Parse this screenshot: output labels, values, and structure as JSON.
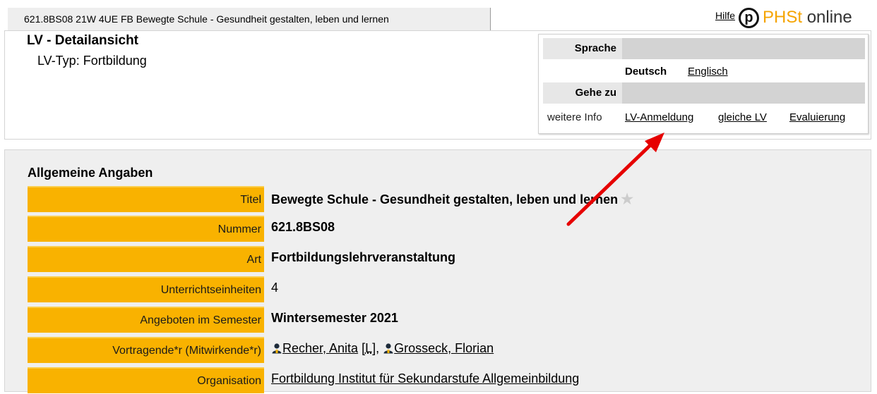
{
  "top_tab": {
    "title": "621.8BS08 21W 4UE FB Bewegte Schule - Gesundheit gestalten, leben und lernen"
  },
  "header": {
    "help_label": "Hilfe",
    "brand": {
      "logo_letter": "p",
      "name_part1": "PHSt",
      "name_part2": "online"
    },
    "page_title": "LV - Detailansicht",
    "lv_type": "LV-Typ: Fortbildung"
  },
  "nav_panel": {
    "language_heading": "Sprache",
    "language_current": "Deutsch",
    "language_alt": "Englisch",
    "goto_heading": "Gehe zu",
    "goto_static": "weitere Info",
    "goto_links": [
      "LV-Anmeldung",
      "gleiche LV",
      "Evaluierung"
    ]
  },
  "details": {
    "section_title": "Allgemeine Angaben",
    "rows": [
      {
        "label": "Titel",
        "value": "Bewegte Schule - Gesundheit gestalten, leben und lernen"
      },
      {
        "label": "Nummer",
        "value": "621.8BS08"
      },
      {
        "label": "Art",
        "value": "Fortbildungslehrveranstaltung"
      },
      {
        "label": "Unterrichtseinheiten",
        "value": "4"
      },
      {
        "label": "Angeboten im Semester",
        "value": "Wintersemester 2021"
      },
      {
        "label": "Vortragende*r (Mitwirkende*r)",
        "lecturer1": "Recher, Anita",
        "role1": "[L]",
        "separator": ",",
        "lecturer2": "Grosseck, Florian"
      },
      {
        "label": "Organisation",
        "value": "Fortbildung Institut für Sekundarstufe Allgemeinbildung"
      }
    ]
  },
  "colors": {
    "label_bg": "#f9b200",
    "brand_orange": "#f5a400",
    "annotation_arrow": "#e60000"
  },
  "icons": {
    "favorite": "star-icon",
    "person": "person-icon"
  }
}
